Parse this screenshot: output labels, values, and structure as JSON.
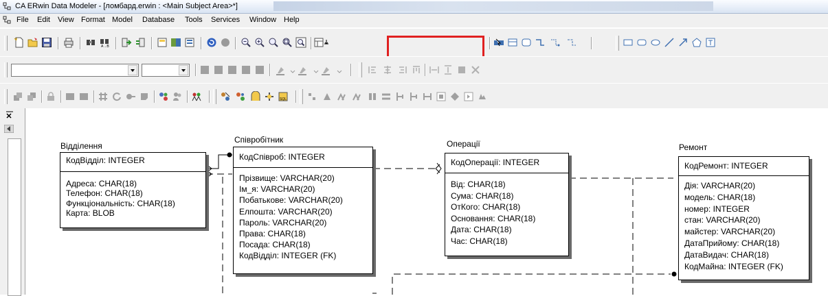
{
  "window": {
    "title": "CA ERwin Data Modeler - [ломбард.erwin : <Main Subject Area>*]"
  },
  "menu": {
    "items": [
      "File",
      "Edit",
      "View",
      "Format",
      "Model",
      "Database",
      "Tools",
      "Services",
      "Window",
      "Help"
    ]
  },
  "toolbar": {
    "model_type": "Physical",
    "highlight_color": "#e02020"
  },
  "entities": [
    {
      "name": "Відділення",
      "pk": "КодВідділ: INTEGER",
      "attributes": [
        "Адреса: CHAR(18)",
        "Телефон: CHAR(18)",
        "Функціональність: CHAR(18)",
        "Карта: BLOB"
      ]
    },
    {
      "name": "Співробітник",
      "pk": "КодСпівроб: INTEGER",
      "attributes": [
        "Прізвище: VARCHAR(20)",
        "Ім_я: VARCHAR(20)",
        "Побатькове: VARCHAR(20)",
        "Елпошта: VARCHAR(20)",
        "Пароль: VARCHAR(20)",
        "Права: CHAR(18)",
        "Посада: CHAR(18)",
        "КодВідділ: INTEGER (FK)"
      ]
    },
    {
      "name": "Операції",
      "pk": "КодОперації: INTEGER",
      "attributes": [
        "Від: CHAR(18)",
        "Сума: CHAR(18)",
        "ОтКого: CHAR(18)",
        "Основання: CHAR(18)",
        "Дата: CHAR(18)",
        "Час: CHAR(18)"
      ]
    },
    {
      "name": "Ремонт",
      "pk": "КодРемонт: INTEGER",
      "attributes": [
        "Дія: VARCHAR(20)",
        "модель: CHAR(18)",
        "номер: INTEGER",
        "стан: VARCHAR(20)",
        "майстер: VARCHAR(20)",
        "ДатаПрийому: CHAR(18)",
        "ДатаВидач: CHAR(18)",
        "КодМайна: INTEGER (FK)"
      ]
    }
  ]
}
